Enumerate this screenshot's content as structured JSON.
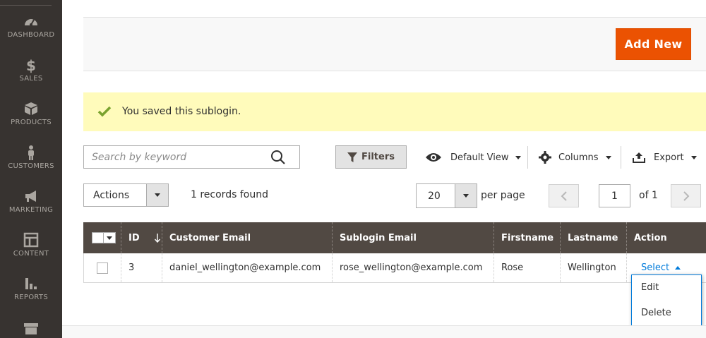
{
  "sidebar": {
    "items": [
      {
        "label": "DASHBOARD",
        "icon": "dashboard-icon"
      },
      {
        "label": "SALES",
        "icon": "dollar-icon"
      },
      {
        "label": "PRODUCTS",
        "icon": "box-icon"
      },
      {
        "label": "CUSTOMERS",
        "icon": "person-icon"
      },
      {
        "label": "MARKETING",
        "icon": "megaphone-icon"
      },
      {
        "label": "CONTENT",
        "icon": "layout-icon"
      },
      {
        "label": "REPORTS",
        "icon": "bar-chart-icon"
      },
      {
        "label": "",
        "icon": "store-icon"
      }
    ]
  },
  "toolbar": {
    "add_new_label": "Add New"
  },
  "message": {
    "text": "You saved this sublogin."
  },
  "search": {
    "placeholder": "Search by keyword"
  },
  "controls": {
    "filters_label": "Filters",
    "view_label": "Default View",
    "columns_label": "Columns",
    "export_label": "Export",
    "actions_label": "Actions",
    "records_found": "1 records found",
    "per_page_value": "20",
    "per_page_label": "per page",
    "page_current": "1",
    "page_of": "of 1"
  },
  "grid": {
    "columns": [
      "ID",
      "Customer Email",
      "Sublogin Email",
      "Firstname",
      "Lastname",
      "Action"
    ],
    "rows": [
      {
        "id": "3",
        "customer_email": "daniel_wellington@example.com",
        "sublogin_email": "rose_wellington@example.com",
        "firstname": "Rose",
        "lastname": "Wellington",
        "action": "Select"
      }
    ]
  },
  "action_menu": {
    "items": [
      "Edit",
      "Delete"
    ]
  },
  "colors": {
    "accent": "#eb5202",
    "header": "#514943",
    "sidebar": "#373330",
    "link": "#007bdb",
    "message_bg": "#fffbbb"
  }
}
